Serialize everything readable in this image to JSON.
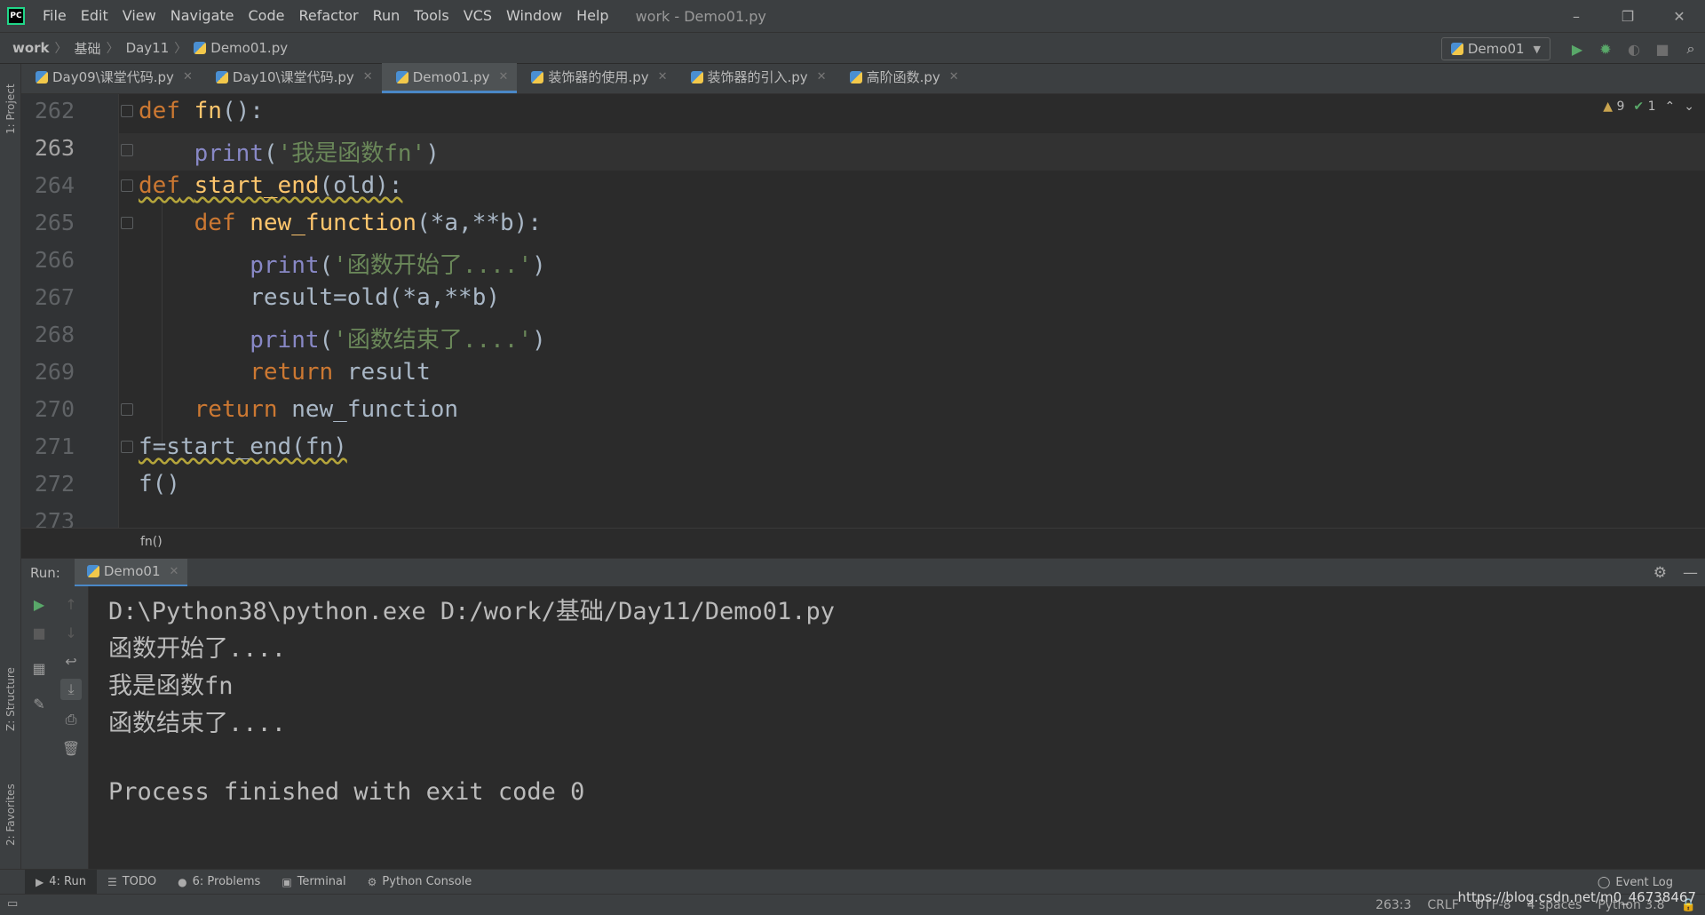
{
  "menubar": {
    "logo": "PC",
    "items": [
      "File",
      "Edit",
      "View",
      "Navigate",
      "Code",
      "Refactor",
      "Run",
      "Tools",
      "VCS",
      "Window",
      "Help"
    ],
    "title": "work - Demo01.py",
    "controls": {
      "minimize": "–",
      "restore": "❐",
      "close": "✕"
    }
  },
  "navbar": {
    "breadcrumbs": [
      "work",
      "基础",
      "Day11",
      "Demo01.py"
    ],
    "run_config": "Demo01",
    "icons": [
      "run-icon",
      "debug-icon",
      "coverage-icon",
      "stop-icon",
      "search-icon"
    ]
  },
  "left_strip": {
    "project": "1: Project",
    "structure": "Z: Structure",
    "favorites": "2: Favorites"
  },
  "editor_tabs": [
    {
      "label": "Day09\\课堂代码.py",
      "active": false
    },
    {
      "label": "Day10\\课堂代码.py",
      "active": false
    },
    {
      "label": "Demo01.py",
      "active": true
    },
    {
      "label": "装饰器的使用.py",
      "active": false
    },
    {
      "label": "装饰器的引入.py",
      "active": false
    },
    {
      "label": "高阶函数.py",
      "active": false
    }
  ],
  "inspection": {
    "warnings": "9",
    "ok": "1"
  },
  "editor": {
    "line_numbers": [
      "262",
      "263",
      "264",
      "265",
      "266",
      "267",
      "268",
      "269",
      "270",
      "271",
      "272",
      "273"
    ],
    "current_line": "263",
    "breadcrumb": "fn()"
  },
  "code": {
    "l262_kw": "def",
    "l262_fn": "fn",
    "l262_rest": "():",
    "l263_bi": "print",
    "l263_open": "(",
    "l263_str": "'我是函数fn'",
    "l263_close": ")",
    "l264_kw": "def",
    "l264_fn": "start_end",
    "l264_rest": "(old):",
    "l265_kw": "def",
    "l265_fn": "new_function",
    "l265_rest": "(*a,**b):",
    "l266_bi": "print",
    "l266_open": "(",
    "l266_str": "'函数开始了....'",
    "l266_close": ")",
    "l267": "result=old(*a,**b)",
    "l268_bi": "print",
    "l268_open": "(",
    "l268_str": "'函数结束了....'",
    "l268_close": ")",
    "l269_kw": "return",
    "l269_rest": " result",
    "l270_kw": "return",
    "l270_rest": " new_function",
    "l271": "f=start_end(fn)",
    "l272": "f()"
  },
  "run_panel": {
    "label": "Run:",
    "tab": "Demo01",
    "console": [
      "D:\\Python38\\python.exe D:/work/基础/Day11/Demo01.py",
      "函数开始了....",
      "我是函数fn",
      "函数结束了....",
      "",
      "Process finished with exit code 0"
    ]
  },
  "toolwindows": {
    "run": "4: Run",
    "todo": "TODO",
    "problems": "6: Problems",
    "terminal": "Terminal",
    "python_console": "Python Console",
    "event_log": "Event Log"
  },
  "statusbar": {
    "position": "263:3",
    "line_sep": "CRLF",
    "encoding": "UTF-8",
    "indent": "4 spaces",
    "interpreter": "Python 3.8",
    "watermark": "https://blog.csdn.net/m0_46738467"
  },
  "colors": {
    "accent": "#4a88c7",
    "keyword": "#cc7832",
    "function": "#ffc66d",
    "string": "#6a8759",
    "builtin": "#8888c6",
    "run_green": "#59a869"
  }
}
